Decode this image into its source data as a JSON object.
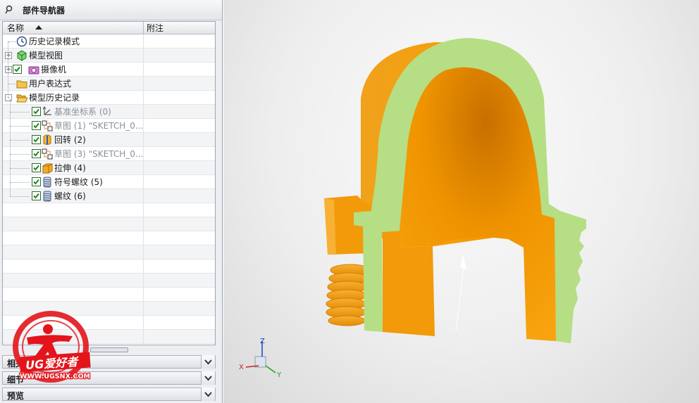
{
  "navigator": {
    "title": "部件导航器",
    "columns": {
      "name": "名称",
      "note": "附注"
    },
    "rows": [
      {
        "label": "历史记录模式",
        "icon": "clock-icon",
        "level": 1,
        "expander": "",
        "checked": false,
        "grey": false
      },
      {
        "label": "模型视图",
        "icon": "model-view-icon",
        "level": 1,
        "expander": "+",
        "checked": false,
        "grey": false
      },
      {
        "label": "摄像机",
        "icon": "camera-icon",
        "level": 1,
        "expander": "+",
        "checked": true,
        "grey": false
      },
      {
        "label": "用户表达式",
        "icon": "folder-icon",
        "level": 1,
        "expander": "",
        "checked": false,
        "grey": false
      },
      {
        "label": "模型历史记录",
        "icon": "folder-open-icon",
        "level": 1,
        "expander": "-",
        "checked": false,
        "grey": false
      },
      {
        "label": "基准坐标系 (0)",
        "icon": "datum-csys-icon",
        "level": 2,
        "expander": "",
        "checked": true,
        "grey": true
      },
      {
        "label": "草图 (1) \"SKETCH_0...",
        "icon": "sketch-icon",
        "level": 2,
        "expander": "",
        "checked": true,
        "grey": true
      },
      {
        "label": "回转 (2)",
        "icon": "revolve-icon",
        "level": 2,
        "expander": "",
        "checked": true,
        "grey": false
      },
      {
        "label": "草图 (3) \"SKETCH_0...",
        "icon": "sketch-icon",
        "level": 2,
        "expander": "",
        "checked": true,
        "grey": true
      },
      {
        "label": "拉伸 (4)",
        "icon": "extrude-icon",
        "level": 2,
        "expander": "",
        "checked": true,
        "grey": false
      },
      {
        "label": "符号螺纹 (5)",
        "icon": "thread-icon",
        "level": 2,
        "expander": "",
        "checked": true,
        "grey": false
      },
      {
        "label": "螺纹 (6)",
        "icon": "thread-icon",
        "level": 2,
        "expander": "",
        "checked": true,
        "grey": false
      }
    ]
  },
  "panels": [
    {
      "label": "相关性"
    },
    {
      "label": "细节"
    },
    {
      "label": "预览"
    }
  ],
  "watermark": {
    "brand": "UG爱好者",
    "url": "WWW.UGSNX.COM"
  },
  "triad": {
    "x": "X",
    "y": "Y",
    "z": "Z"
  },
  "colors": {
    "part_orange": "#f29a0a",
    "section_green": "#b6de84",
    "watermark_red": "#e3141b"
  }
}
